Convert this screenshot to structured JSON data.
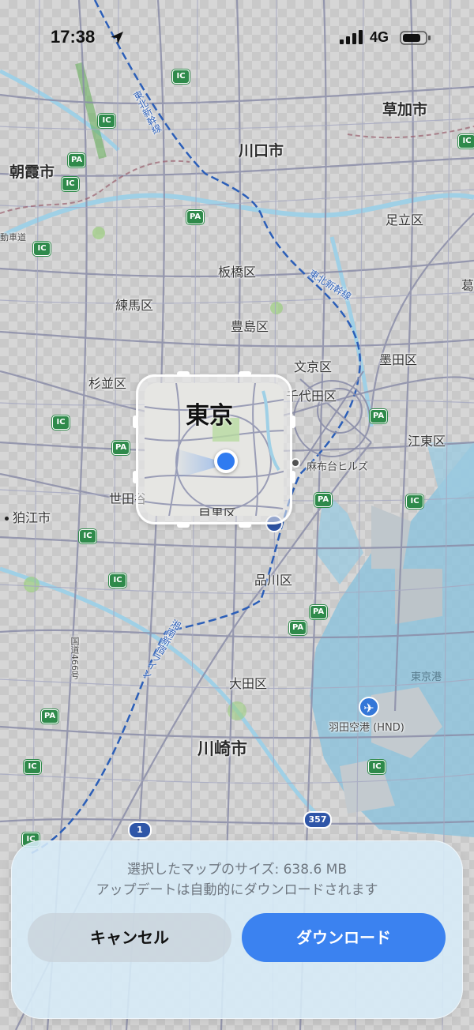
{
  "status_bar": {
    "time": "17:38",
    "network": "4G"
  },
  "map": {
    "labels": {
      "soka": "草加市",
      "kawaguchi": "川口市",
      "asaka": "朝霞市",
      "adachi": "足立区",
      "itabashi": "板橋区",
      "nerima": "練馬区",
      "toshima": "豊島区",
      "bunkyo": "文京区",
      "sumida": "墨田区",
      "suginami": "杉並区",
      "chiyoda": "千代田区",
      "koto": "江東区",
      "azabudai": "麻布台ヒルズ",
      "setagaya": "世田谷区",
      "komae": "狛江市",
      "shinagawa": "品川区",
      "ota": "大田区",
      "kawasaki": "川崎市",
      "haneda": "羽田空港 (HND)",
      "tokyo_port": "東京港",
      "tohoku_shinkansen_1": "東北新幹線",
      "tohoku_shinkansen_2": "東北新幹線",
      "yokosuka_line": "湘南新宿ライン",
      "kokudo": "国道466号",
      "edge_katsushika": "葛",
      "edge_road": "動車道"
    },
    "badges": {
      "ic": "IC",
      "pa": "PA"
    },
    "route_shields": {
      "r1": "1",
      "r357": "357"
    },
    "selection": {
      "city": "東京",
      "ward": "目黒区"
    }
  },
  "sheet": {
    "size_text": "選択したマップのサイズ: 638.6 MB",
    "update_text": "アップデートは自動的にダウンロードされます",
    "cancel_label": "キャンセル",
    "download_label": "ダウンロード"
  },
  "colors": {
    "accent": "#3b82f0",
    "badge_green": "#2f8a4b",
    "rail_blue": "#2c5fb8",
    "water": "#8fc3dc"
  }
}
